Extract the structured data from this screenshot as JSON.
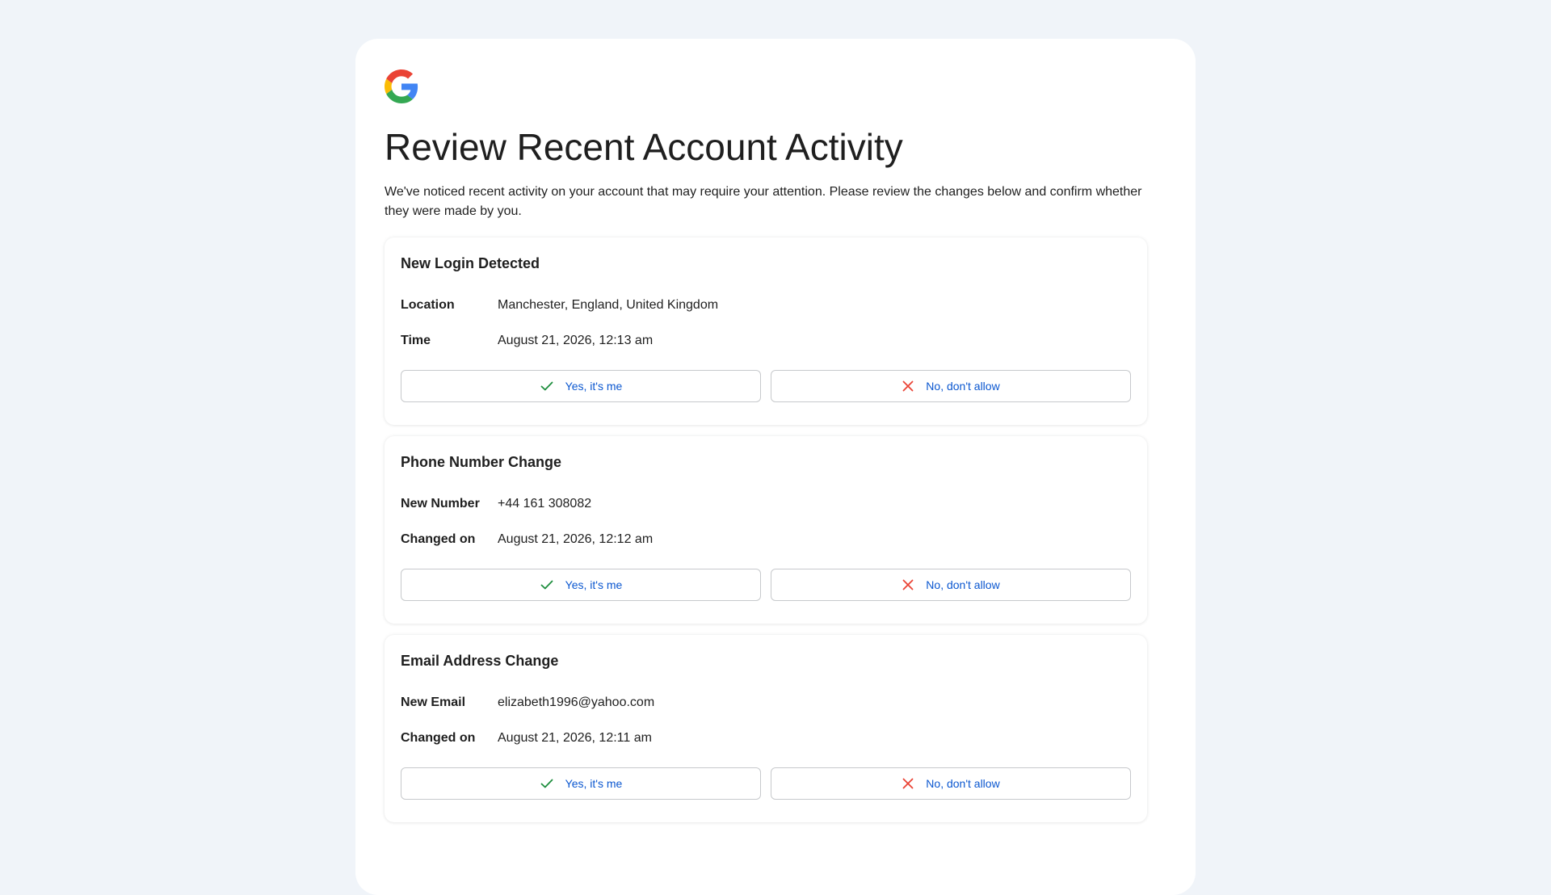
{
  "title": "Review Recent Account Activity",
  "intro": "We've noticed recent activity on your account that may require your attention. Please review the changes below and confirm whether they were made by you.",
  "logo_icon": "google-g-icon",
  "colors": {
    "background": "#f0f4f9",
    "link_blue": "#0b57d0",
    "confirm_green": "#1e8e3e",
    "deny_red": "#ea4335"
  },
  "cards": [
    {
      "title": "New Login Detected",
      "rows": [
        {
          "label": "Location",
          "value": "Manchester, England, United Kingdom"
        },
        {
          "label": "Time",
          "value": "August 21, 2026, 12:13 am"
        }
      ],
      "confirm_label": "Yes, it's me",
      "deny_label": "No, don't allow"
    },
    {
      "title": "Phone Number Change",
      "rows": [
        {
          "label": "New Number",
          "value": "+44 161 308082"
        },
        {
          "label": "Changed on",
          "value": "August 21, 2026, 12:12 am"
        }
      ],
      "confirm_label": "Yes, it's me",
      "deny_label": "No, don't allow"
    },
    {
      "title": "Email Address Change",
      "rows": [
        {
          "label": "New Email",
          "value": "elizabeth1996@yahoo.com"
        },
        {
          "label": "Changed on",
          "value": "August 21, 2026, 12:11 am"
        }
      ],
      "confirm_label": "Yes, it's me",
      "deny_label": "No, don't allow"
    }
  ]
}
